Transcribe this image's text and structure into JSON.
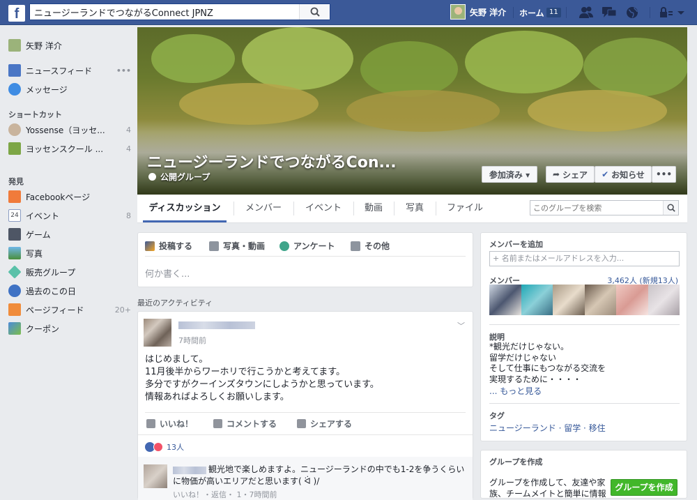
{
  "topbar": {
    "logo": "f",
    "search_value": "ニュージーランドでつながるConnect JPNZ",
    "user_name": "矢野 洋介",
    "home_label": "ホーム",
    "home_badge": "11",
    "icons": [
      "friends-icon",
      "messages-icon",
      "globe-icon",
      "privacy-icon"
    ]
  },
  "left_nav": {
    "profile_name": "矢野 洋介",
    "main_items": [
      {
        "label": "ニュースフィード",
        "icon": "newsfeed-icon",
        "extra": "•••"
      },
      {
        "label": "メッセージ",
        "icon": "messenger-icon"
      }
    ],
    "shortcuts_title": "ショートカット",
    "shortcuts": [
      {
        "label": "Yossense（ヨッセ...",
        "count": "4"
      },
      {
        "label": "ヨッセンスクール ...",
        "count": "4"
      }
    ],
    "explore_title": "発見",
    "explore": [
      {
        "label": "Facebookページ",
        "icon": "flag-icon",
        "count": ""
      },
      {
        "label": "イベント",
        "icon": "calendar-icon",
        "count": "8",
        "icon_text": "24"
      },
      {
        "label": "ゲーム",
        "icon": "game-icon",
        "count": ""
      },
      {
        "label": "写真",
        "icon": "photo-icon",
        "count": ""
      },
      {
        "label": "販売グループ",
        "icon": "tag-icon",
        "count": ""
      },
      {
        "label": "過去のこの日",
        "icon": "clock-icon",
        "count": ""
      },
      {
        "label": "ページフィード",
        "icon": "pagefeed-icon",
        "count": "20+"
      },
      {
        "label": "クーポン",
        "icon": "coupon-icon",
        "count": ""
      }
    ]
  },
  "cover": {
    "title": "ニュージーランドでつながるCon...",
    "privacy": "公開グループ",
    "joined_button": "参加済み ▾",
    "share_button": "シェア",
    "notify_button": "お知らせ",
    "more_button": "•••"
  },
  "tabs": [
    "ディスカッション",
    "メンバー",
    "イベント",
    "動画",
    "写真",
    "ファイル"
  ],
  "group_search_placeholder": "このグループを検索",
  "composer": {
    "tabs": [
      "投稿する",
      "写真・動画",
      "アンケート",
      "その他"
    ],
    "placeholder": "何か書く..."
  },
  "recent_label": "最近のアクティビティ",
  "post": {
    "time": "7時間前",
    "lines": [
      "はじめまして。",
      "11月後半からワーホリで行こうかと考えてます。",
      "多分ですがクーインズタウンにしようかと思っています。",
      "情報あればよろしくお願いします。"
    ],
    "like": "いいね！",
    "comment": "コメントする",
    "share": "シェアする",
    "reactions": "13人",
    "comment_text": "観光地で楽しめますよ。ニュージーランドの中でも1-2を争うくらい",
    "comment_text2": "に物価が高いエリアだと思います( ᐛ )/",
    "comment_meta": "いいね！・返信・ 1・7時間前"
  },
  "right": {
    "add_member_title": "メンバーを追加",
    "add_member_placeholder": "+ 名前またはメールアドレスを入力...",
    "members_title": "メンバー",
    "members_count": "3,462人 (新規13人)",
    "description_title": "説明",
    "description": "*観光だけじゃない。\n留学だけじゃない\nそして仕事にもつながる交流を\n実現するために・・・・",
    "see_more": "... もっと見る",
    "tags_title": "タグ",
    "tags": "ニュージーランド · 留学 · 移住",
    "create_title": "グループを作成",
    "create_text": "グループを作成して、友達や家",
    "create_text2": "族、チームメイトと簡単に情報",
    "create_button": "グループを作成"
  },
  "colors": {
    "brand": "#3b5998",
    "link": "#365899",
    "green": "#42b72a"
  }
}
